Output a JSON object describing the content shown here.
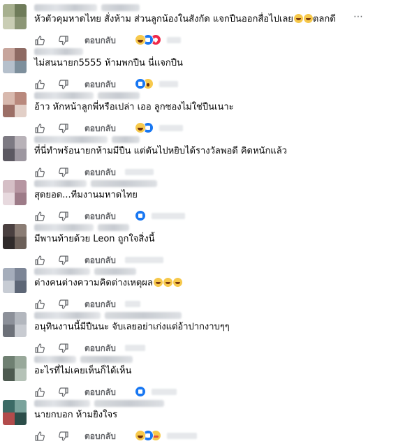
{
  "reply_label": "ตอบกลับ",
  "icons": {
    "like": "like-icon",
    "dislike": "dislike-icon",
    "more": "more-options-icon"
  },
  "comments": [
    {
      "text": "หัวตัวคุมหาดไทย สั่งห้าม ส่วนลูกน้องในสังกัด แจกปืนออกสื่อไปเลย",
      "text_after_emoji": "ตลกดี",
      "text_emojis": [
        "haha",
        "haha"
      ],
      "reactions": [
        "haha",
        "like",
        "love"
      ]
    },
    {
      "text": "ไม่สนนายก5555 ห้ามพกปืน นี่แจกปืน",
      "reactions": [
        "like",
        "wow"
      ]
    },
    {
      "text": "อ้าว หักหน้าลูกพี่หรือเปล่า เออ ลูกซองไม่ใช่ปืนเนาะ",
      "reactions": [
        "haha",
        "like"
      ]
    },
    {
      "text": "ที่นี่ทำพร้อนายกห้ามมีปืน แต่ดันไปหยิบได้รางวัลพอดี คิดหนักแล้ว",
      "reactions": []
    },
    {
      "text": "สุดยอด...ทีมงานมหาดไทย",
      "reactions": [
        "like"
      ]
    },
    {
      "text": "มีพานท้ายด้วย Leon ถูกใจสิ่งนี้",
      "reactions": []
    },
    {
      "text": "ต่างคนต่างความคิดต่างเหตุผล",
      "text_emojis": [
        "haha",
        "haha",
        "haha"
      ],
      "reactions": []
    },
    {
      "text": "อนุทินงานนี้มีปืนนะ จับเลยอย่าเก่งแต่อ้าปากงาบๆๆ",
      "reactions": []
    },
    {
      "text": "อะไรที่ไม่เคยเห็นก็ได้เห็น",
      "reactions": [
        "like"
      ]
    },
    {
      "text": "นายกบอก ห้ามยิงใจร",
      "reactions": [
        "haha",
        "like",
        "care"
      ]
    }
  ]
}
